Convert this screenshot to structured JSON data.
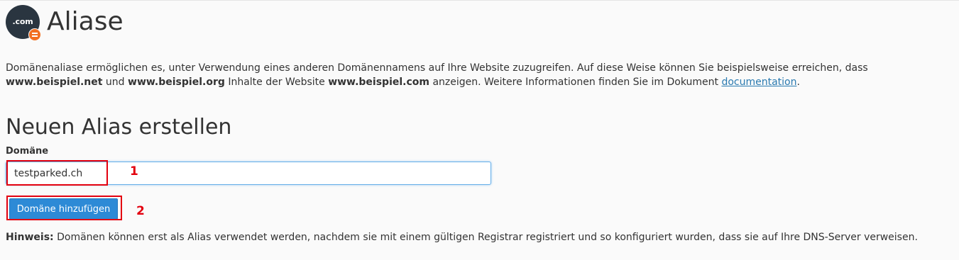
{
  "header": {
    "logo_text": ".com",
    "title": "Aliase"
  },
  "description": {
    "part1": "Domänenaliase ermöglichen es, unter Verwendung eines anderen Domänennamens auf Ihre Website zuzugreifen. Auf diese Weise können Sie beispielsweise erreichen, dass ",
    "domain_net": "www.beispiel.net",
    "part2": " und ",
    "domain_org": "www.beispiel.org",
    "part3": " Inhalte der Website ",
    "domain_com": "www.beispiel.com",
    "part4": " anzeigen. Weitere Informationen finden Sie im Dokument ",
    "link_text": "documentation",
    "part5": "."
  },
  "form": {
    "section_title": "Neuen Alias erstellen",
    "domain_label": "Domäne",
    "domain_value": "testparked.ch",
    "submit_label": "Domäne hinzufügen"
  },
  "annotations": {
    "step1": "1",
    "step2": "2",
    "color": "#e3000f"
  },
  "hint": {
    "label": "Hinweis:",
    "text": " Domänen können erst als Alias verwendet werden, nachdem sie mit einem gültigen Registrar registriert und so konfiguriert wurden, dass sie auf Ihre DNS-Server verweisen."
  },
  "colors": {
    "primary_button": "#2d8ad6",
    "link": "#2a7ab0",
    "badge": "#f26f21",
    "logo": "#2a3540"
  }
}
